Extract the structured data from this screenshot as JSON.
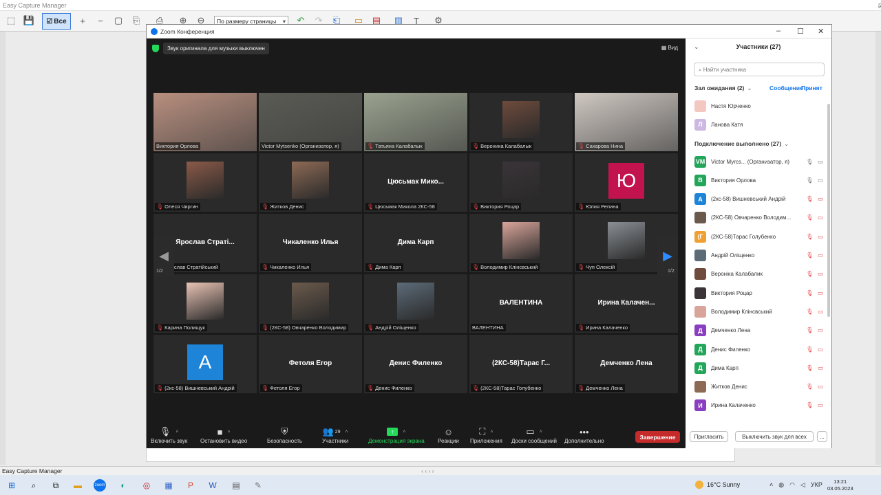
{
  "capture_app": {
    "title": "Easy Capture Manager",
    "all_button": "Все",
    "zoom_select": "По размеру страницы",
    "status": "Easy Capture Manager",
    "scroll_indicator": "‹ ‹ ›  ›"
  },
  "zoom": {
    "title": "Zoom Конференция",
    "banner": "Звук оригинала для музыки выключен",
    "view_label": "Вид",
    "page_indicator_left": "1/2",
    "page_indicator_right": "1/2",
    "tiles": [
      {
        "label": "Виктория Орлова",
        "kind": "photo",
        "bg": "#b88f7f",
        "muted": false
      },
      {
        "label": "Victor Mytsenko (Организатор, я)",
        "kind": "photo",
        "bg": "#5b5b55",
        "muted": false,
        "active": true
      },
      {
        "label": "Татьяна Калабалык",
        "kind": "photo",
        "bg": "#9aa28f",
        "muted": true
      },
      {
        "label": "Вероника Калабалык",
        "kind": "thumb",
        "bg": "#6e4b3c",
        "muted": true
      },
      {
        "label": "Сахарова Нина",
        "kind": "photo",
        "bg": "#cfc8c2",
        "muted": true
      },
      {
        "label": "Олеся Чиргин",
        "kind": "thumb",
        "bg": "#8a5a48",
        "muted": true
      },
      {
        "label": "Житков Денис",
        "kind": "thumb",
        "bg": "#8d6a55",
        "muted": true
      },
      {
        "label": "Цюсьмак Микола 2КС-58",
        "kind": "name",
        "big": "Цюсьмак  Мико...",
        "muted": true
      },
      {
        "label": "Виктория Роцар",
        "kind": "thumb",
        "bg": "#3a3438",
        "muted": true
      },
      {
        "label": "Юлия Репина",
        "kind": "avatar",
        "letter": "Ю",
        "bg": "#c3134f",
        "muted": true
      },
      {
        "label": "Ярослав Стратійський",
        "kind": "name",
        "big": "Ярослав  Страті...",
        "muted": true
      },
      {
        "label": "Чикаленко Илья",
        "kind": "name",
        "big": "Чикаленко Илья",
        "muted": true
      },
      {
        "label": "Дима Карп",
        "kind": "name",
        "big": "Дима Карп",
        "muted": true
      },
      {
        "label": "Володимир Клінсвський",
        "kind": "thumb",
        "bg": "#d9a59a",
        "muted": true
      },
      {
        "label": "Чуп Олексій",
        "kind": "thumb",
        "bg": "#8a8f95",
        "muted": true
      },
      {
        "label": "Карина Полищук",
        "kind": "thumb",
        "bg": "#e9c3b4",
        "muted": true
      },
      {
        "label": "(2КС-58) Овчаренко Володимир",
        "kind": "thumb",
        "bg": "#6b5a4c",
        "muted": true
      },
      {
        "label": "Андрій Оліщенко",
        "kind": "thumb",
        "bg": "#5c6b78",
        "muted": true
      },
      {
        "label": "ВАЛЕНТИНА",
        "kind": "name",
        "big": "ВАЛЕНТИНА",
        "muted": false
      },
      {
        "label": "Ирина Калаченко",
        "kind": "name",
        "big": "Ирина  Калачен...",
        "muted": true
      },
      {
        "label": "(2кс-58) Вишневський Андрій",
        "kind": "avatar",
        "letter": "А",
        "bg": "#1d84d8",
        "muted": true
      },
      {
        "label": "Фетоля Егор",
        "kind": "name",
        "big": "Фетоля Егор",
        "muted": true
      },
      {
        "label": "Денис Филенко",
        "kind": "name",
        "big": "Денис Филенко",
        "muted": true
      },
      {
        "label": "(2КС-58)Тарас Голубенко",
        "kind": "name",
        "big": "(2КС-58)Тарас Г...",
        "muted": true
      },
      {
        "label": "Демченко Лена",
        "kind": "name",
        "big": "Демченко Лена",
        "muted": true
      }
    ],
    "toolbar": [
      {
        "label": "Включить звук",
        "icon": "microphone-icon",
        "glyph": "🎙",
        "caret": true
      },
      {
        "label": "Остановить видео",
        "icon": "video-icon",
        "glyph": "■",
        "caret": true
      },
      {
        "label": "Безопасность",
        "icon": "shield-icon",
        "glyph": "⛨",
        "caret": false
      },
      {
        "label": "Участники",
        "icon": "participants-icon",
        "glyph": "👥",
        "count": "29",
        "caret": true
      },
      {
        "label": "Демонстрация экрана",
        "icon": "share-screen-icon",
        "glyph": "↑",
        "caret": true
      },
      {
        "label": "Реакции",
        "icon": "reaction-icon",
        "glyph": "☺",
        "caret": false
      },
      {
        "label": "Приложения",
        "icon": "apps-icon",
        "glyph": "⛶",
        "caret": true
      },
      {
        "label": "Доски сообщений",
        "icon": "whiteboard-icon",
        "glyph": "▭",
        "caret": true
      },
      {
        "label": "Дополнительно",
        "icon": "more-icon",
        "glyph": "•••",
        "caret": false
      }
    ],
    "end_button": "Завершение"
  },
  "participants": {
    "title": "Участники (27)",
    "search_placeholder": "Найти участника",
    "waiting_header": "Зал ожидания (2)",
    "waiting_message": "Сообщение",
    "waiting_admit": "Принят",
    "waiting": [
      {
        "name": "Настя Юрченко",
        "bg": "#f2c8c0",
        "letter": ""
      },
      {
        "name": "Ланова Катя",
        "bg": "#cdb8e3",
        "letter": "Л"
      }
    ],
    "connected_header": "Подключение выполнено (27)",
    "list": [
      {
        "name": "Victor Myrcs...  (Организатор, я)",
        "letter": "VM",
        "bg": "#23a55a",
        "mic": "🎙",
        "cam": "▭",
        "muted": false
      },
      {
        "name": "Виктория Орлова",
        "letter": "В",
        "bg": "#23a55a",
        "mic": "🎙",
        "cam": "▭",
        "muted": false
      },
      {
        "name": "(2кс-58) Вишневський Андрій",
        "letter": "А",
        "bg": "#1d84d8",
        "mic": "🎙",
        "cam": "▭",
        "muted": true
      },
      {
        "name": "(2КС-58) Овчаренко Володим...",
        "letter": "",
        "bg": "#6b5a4c",
        "mic": "🎙",
        "cam": "▭",
        "muted": true
      },
      {
        "name": "(2КС-58)Тарас Голубенко",
        "letter": "(Г",
        "bg": "#f0a030",
        "mic": "🎙",
        "cam": "▭",
        "muted": true
      },
      {
        "name": "Андрій Оліщенко",
        "letter": "",
        "bg": "#5c6b78",
        "mic": "🎙",
        "cam": "▭",
        "muted": true
      },
      {
        "name": "Вероніка Калабалик",
        "letter": "",
        "bg": "#6e4b3c",
        "mic": "🎙",
        "cam": "▭",
        "muted": true
      },
      {
        "name": "Виктория Роцар",
        "letter": "",
        "bg": "#3a3438",
        "mic": "🎙",
        "cam": "▭",
        "muted": true
      },
      {
        "name": "Володимир Клінсвський",
        "letter": "",
        "bg": "#d9a59a",
        "mic": "🎙",
        "cam": "▭",
        "muted": true
      },
      {
        "name": "Демченко Лена",
        "letter": "Д",
        "bg": "#8a3fc0",
        "mic": "🎙",
        "cam": "▭",
        "muted": true
      },
      {
        "name": "Денис Филенко",
        "letter": "Д",
        "bg": "#23a55a",
        "mic": "🎙",
        "cam": "▭",
        "muted": true
      },
      {
        "name": "Дима Карп",
        "letter": "Д",
        "bg": "#23a55a",
        "mic": "🎙",
        "cam": "▭",
        "muted": true
      },
      {
        "name": "Житков Денис",
        "letter": "",
        "bg": "#8d6a55",
        "mic": "🎙",
        "cam": "▭",
        "muted": true
      },
      {
        "name": "Ирина Калаченко",
        "letter": "И",
        "bg": "#8a3fc0",
        "mic": "🎙",
        "cam": "▭",
        "muted": true
      }
    ],
    "invite_button": "Пригласить",
    "mute_all_button": "Выключить звук для всех",
    "more_button": "..."
  },
  "taskbar": {
    "weather": "16°C  Sunny",
    "lang": "УКР",
    "time": "13:21",
    "date": "03.05.2023"
  }
}
